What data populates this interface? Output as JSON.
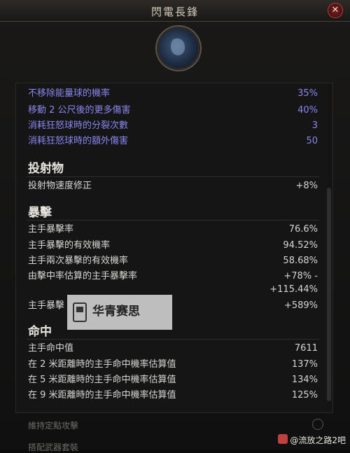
{
  "window": {
    "title": "閃電長鋒",
    "close_icon_glyph": "✕"
  },
  "skill_gem_icon": "lightning-orb-gem-icon",
  "blue_stats": [
    {
      "label": "不移除能量球的機率",
      "value": "35%"
    },
    {
      "label": "移動 2 公尺後的更多傷害",
      "value": "40%"
    },
    {
      "label": "消耗狂怒球時的分裂次數",
      "value": "3"
    },
    {
      "label": "消耗狂怒球時的額外傷害",
      "value": "50"
    }
  ],
  "sections": {
    "projectile": {
      "title": "投射物",
      "rows": [
        {
          "label": "投射物速度修正",
          "value": "+8%"
        }
      ]
    },
    "crit": {
      "title": "暴擊",
      "rows": [
        {
          "label": "主手暴擊率",
          "value": "76.6%"
        },
        {
          "label": "主手暴擊的有效機率",
          "value": "94.52%"
        },
        {
          "label": "主手兩次暴擊的有效機率",
          "value": "58.68%"
        },
        {
          "label": "由擊中率估算的主手暴擊率",
          "value": "+78% -"
        },
        {
          "label": "",
          "value": "+115.44%"
        },
        {
          "label": "主手暴擊",
          "value": "+589%"
        }
      ]
    },
    "accuracy": {
      "title": "命中",
      "rows": [
        {
          "label": "主手命中值",
          "value": "7611"
        },
        {
          "label": "在 2 米距離時的主手命中機率估算值",
          "value": "137%"
        },
        {
          "label": "在 5 米距離時的主手命中機率估算值",
          "value": "134%"
        },
        {
          "label": "在 9 米距離時的主手命中機率估算值",
          "value": "125%"
        }
      ]
    }
  },
  "watermark": {
    "text": "华青赛思"
  },
  "footer": {
    "option1": "維持定點攻擊",
    "option2": "搭配武器套裝",
    "credit": "@流放之路2吧"
  }
}
